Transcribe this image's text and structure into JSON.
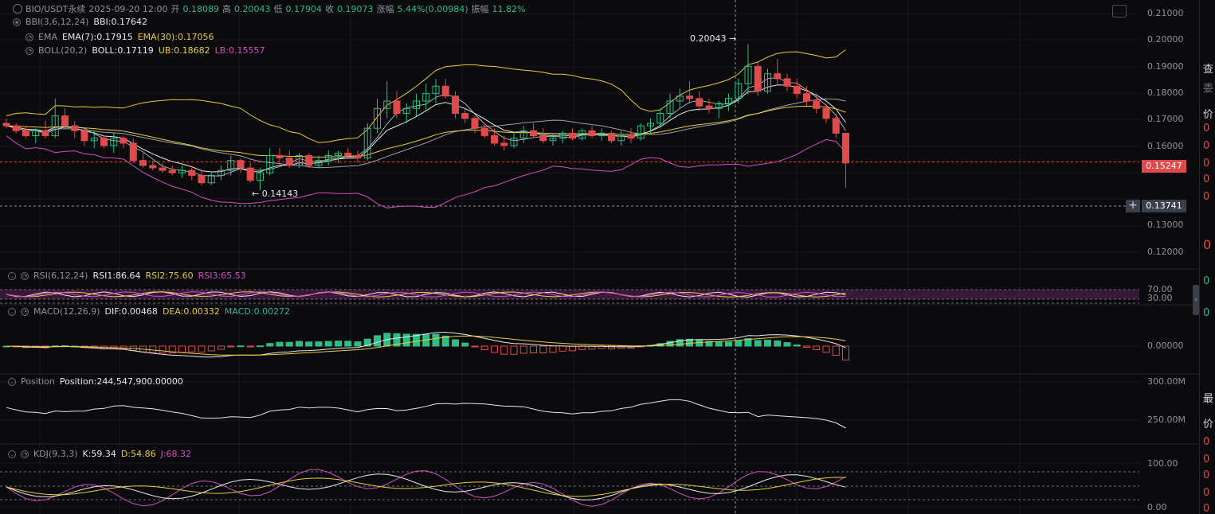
{
  "header": {
    "symbol": "BIO/USDT永续",
    "datetime": "2025-09-20 12:00",
    "open_label": "开",
    "open": "0.18089",
    "high_label": "高",
    "high": "0.20043",
    "low_label": "低",
    "low": "0.17904",
    "close_label": "收",
    "close": "0.19073",
    "change_label": "涨幅",
    "change": "5.44%(0.00984)",
    "amp_label": "振幅",
    "amp": "11.82%"
  },
  "indicators": {
    "bbi": {
      "name": "BBI(3,6,12,24)",
      "v1": "BBI:0.17642"
    },
    "ema": {
      "name": "EMA",
      "v1": "EMA(7):0.17915",
      "v2": "EMA(30):0.17056"
    },
    "boll": {
      "name": "BOLL(20,2)",
      "v1": "BOLL:0.17119",
      "v2": "UB:0.18682",
      "v3": "LB:0.15557"
    },
    "rsi": {
      "name": "RSI(6,12,24)",
      "v1": "RSI1:86.64",
      "v2": "RSI2:75.60",
      "v3": "RSI3:65.53"
    },
    "macd": {
      "name": "MACD(12,26,9)",
      "v1": "DIF:0.00468",
      "v2": "DEA:0.00332",
      "v3": "MACD:0.00272"
    },
    "position": {
      "name": "Position",
      "v1": "Position:244,547,900.00000"
    },
    "kdj": {
      "name": "KDJ(9,3,3)",
      "v1": "K:59.34",
      "v2": "D:54.86",
      "v3": "J:68.32"
    }
  },
  "annotations": {
    "high_marker": "0.20043",
    "low_marker": "0.14143"
  },
  "price_axis": [
    "0.21000",
    "0.20000",
    "0.19000",
    "0.18000",
    "0.17000",
    "0.16000",
    "0.13000",
    "0.12000"
  ],
  "current_price": "0.15247",
  "crosshair_price": "0.13741",
  "crosshair_button": "+",
  "rsi_axis": [
    "70.00",
    "30.00"
  ],
  "macd_axis": [
    "0.00000"
  ],
  "position_axis": [
    "300.00M",
    "250.00M"
  ],
  "kdj_axis": [
    "100.00",
    "0.00"
  ],
  "right_panel_chars": [
    "查",
    "委",
    "价",
    "0",
    "0",
    "0",
    "0",
    "0",
    "0",
    "0",
    "0",
    "最",
    "价",
    "0",
    "0",
    "0",
    "0",
    "0",
    "0"
  ],
  "colors": {
    "up": "#2ebd85",
    "down": "#e04a4a",
    "ema7": "#e6e8ea",
    "ema30": "#e8cc3c",
    "lower": "#d34fc0",
    "bg": "#0b0b0e"
  },
  "chart_data": {
    "type": "candlestick",
    "ylim": [
      0.115,
      0.212
    ],
    "candles_ohlc": [
      [
        0.168,
        0.17,
        0.166,
        0.167
      ],
      [
        0.167,
        0.168,
        0.164,
        0.165
      ],
      [
        0.165,
        0.167,
        0.162,
        0.163
      ],
      [
        0.163,
        0.166,
        0.16,
        0.165
      ],
      [
        0.165,
        0.169,
        0.162,
        0.163
      ],
      [
        0.163,
        0.178,
        0.162,
        0.171
      ],
      [
        0.171,
        0.174,
        0.166,
        0.167
      ],
      [
        0.167,
        0.169,
        0.162,
        0.165
      ],
      [
        0.165,
        0.166,
        0.159,
        0.161
      ],
      [
        0.161,
        0.165,
        0.158,
        0.162
      ],
      [
        0.162,
        0.163,
        0.158,
        0.159
      ],
      [
        0.159,
        0.164,
        0.156,
        0.162
      ],
      [
        0.162,
        0.163,
        0.158,
        0.16
      ],
      [
        0.16,
        0.162,
        0.152,
        0.153
      ],
      [
        0.153,
        0.156,
        0.15,
        0.151
      ],
      [
        0.151,
        0.153,
        0.149,
        0.15
      ],
      [
        0.15,
        0.152,
        0.148,
        0.149
      ],
      [
        0.149,
        0.151,
        0.147,
        0.148
      ],
      [
        0.148,
        0.151,
        0.146,
        0.149
      ],
      [
        0.149,
        0.15,
        0.145,
        0.147
      ],
      [
        0.147,
        0.149,
        0.143,
        0.144
      ],
      [
        0.144,
        0.148,
        0.143,
        0.147
      ],
      [
        0.147,
        0.151,
        0.145,
        0.149
      ],
      [
        0.149,
        0.155,
        0.147,
        0.153
      ],
      [
        0.153,
        0.154,
        0.148,
        0.15
      ],
      [
        0.15,
        0.152,
        0.144,
        0.145
      ],
      [
        0.145,
        0.15,
        0.141,
        0.148
      ],
      [
        0.148,
        0.158,
        0.147,
        0.155
      ],
      [
        0.155,
        0.158,
        0.152,
        0.154
      ],
      [
        0.154,
        0.157,
        0.15,
        0.151
      ],
      [
        0.151,
        0.156,
        0.15,
        0.155
      ],
      [
        0.155,
        0.156,
        0.15,
        0.151
      ],
      [
        0.151,
        0.155,
        0.15,
        0.153
      ],
      [
        0.153,
        0.157,
        0.151,
        0.155
      ],
      [
        0.155,
        0.157,
        0.152,
        0.156
      ],
      [
        0.156,
        0.158,
        0.154,
        0.155
      ],
      [
        0.155,
        0.157,
        0.152,
        0.154
      ],
      [
        0.154,
        0.168,
        0.153,
        0.166
      ],
      [
        0.166,
        0.178,
        0.164,
        0.174
      ],
      [
        0.174,
        0.185,
        0.17,
        0.177
      ],
      [
        0.177,
        0.181,
        0.17,
        0.172
      ],
      [
        0.172,
        0.176,
        0.168,
        0.174
      ],
      [
        0.174,
        0.18,
        0.171,
        0.177
      ],
      [
        0.177,
        0.184,
        0.173,
        0.18
      ],
      [
        0.18,
        0.186,
        0.176,
        0.183
      ],
      [
        0.183,
        0.186,
        0.178,
        0.179
      ],
      [
        0.179,
        0.181,
        0.17,
        0.172
      ],
      [
        0.172,
        0.174,
        0.168,
        0.17
      ],
      [
        0.17,
        0.171,
        0.164,
        0.166
      ],
      [
        0.166,
        0.168,
        0.162,
        0.163
      ],
      [
        0.163,
        0.166,
        0.159,
        0.16
      ],
      [
        0.16,
        0.163,
        0.157,
        0.159
      ],
      [
        0.159,
        0.164,
        0.158,
        0.162
      ],
      [
        0.162,
        0.167,
        0.16,
        0.165
      ],
      [
        0.165,
        0.168,
        0.162,
        0.163
      ],
      [
        0.163,
        0.166,
        0.16,
        0.161
      ],
      [
        0.161,
        0.164,
        0.159,
        0.162
      ],
      [
        0.162,
        0.165,
        0.16,
        0.164
      ],
      [
        0.164,
        0.166,
        0.161,
        0.162
      ],
      [
        0.162,
        0.166,
        0.161,
        0.165
      ],
      [
        0.165,
        0.167,
        0.162,
        0.163
      ],
      [
        0.163,
        0.166,
        0.161,
        0.164
      ],
      [
        0.164,
        0.165,
        0.16,
        0.161
      ],
      [
        0.161,
        0.165,
        0.159,
        0.163
      ],
      [
        0.163,
        0.166,
        0.16,
        0.162
      ],
      [
        0.162,
        0.168,
        0.161,
        0.167
      ],
      [
        0.167,
        0.17,
        0.164,
        0.168
      ],
      [
        0.168,
        0.174,
        0.166,
        0.172
      ],
      [
        0.172,
        0.18,
        0.17,
        0.177
      ],
      [
        0.177,
        0.182,
        0.174,
        0.179
      ],
      [
        0.179,
        0.185,
        0.176,
        0.178
      ],
      [
        0.178,
        0.181,
        0.173,
        0.175
      ],
      [
        0.175,
        0.178,
        0.172,
        0.174
      ],
      [
        0.174,
        0.177,
        0.17,
        0.176
      ],
      [
        0.176,
        0.18,
        0.173,
        0.178
      ],
      [
        0.178,
        0.186,
        0.176,
        0.184
      ],
      [
        0.184,
        0.2,
        0.18,
        0.191
      ],
      [
        0.191,
        0.193,
        0.179,
        0.181
      ],
      [
        0.181,
        0.19,
        0.18,
        0.188
      ],
      [
        0.188,
        0.194,
        0.184,
        0.186
      ],
      [
        0.186,
        0.188,
        0.181,
        0.183
      ],
      [
        0.183,
        0.186,
        0.178,
        0.18
      ],
      [
        0.18,
        0.183,
        0.175,
        0.177
      ],
      [
        0.177,
        0.18,
        0.172,
        0.174
      ],
      [
        0.174,
        0.176,
        0.168,
        0.17
      ],
      [
        0.17,
        0.172,
        0.162,
        0.164
      ],
      [
        0.164,
        0.164,
        0.142,
        0.152
      ]
    ]
  }
}
